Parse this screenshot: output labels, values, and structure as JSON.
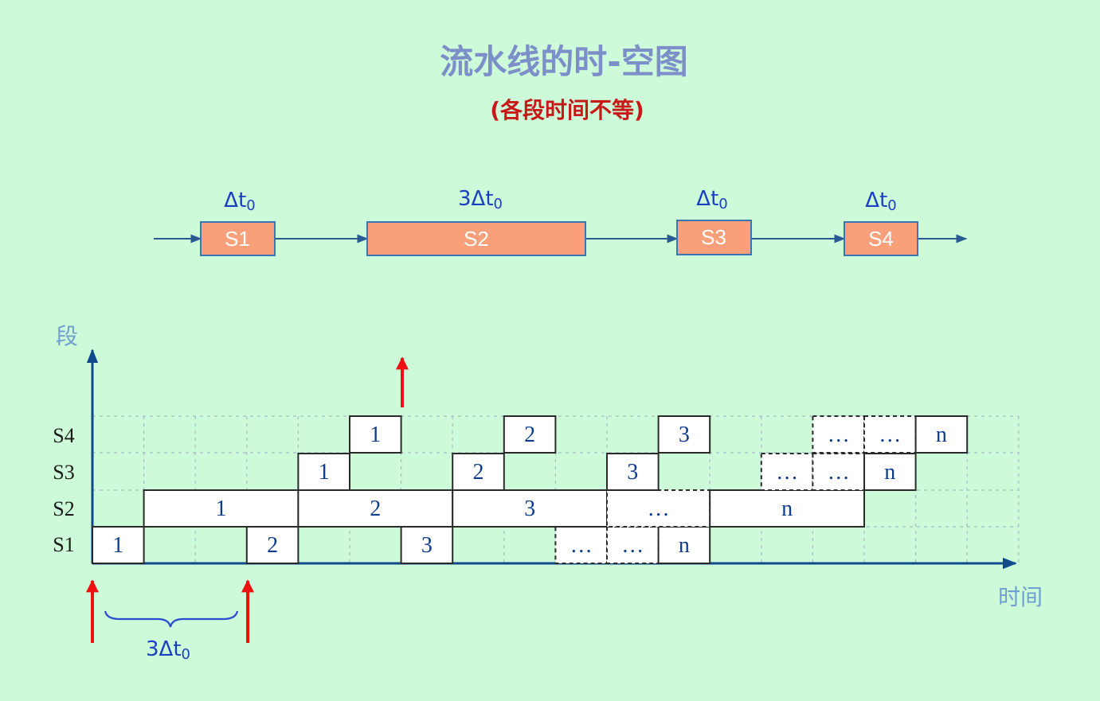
{
  "title": "流水线的时-空图",
  "subtitle": "(各段时间不等)",
  "stages": [
    {
      "name": "S1",
      "duration_label": "Δt",
      "duration_sub": "0"
    },
    {
      "name": "S2",
      "duration_label": "3Δt",
      "duration_sub": "0"
    },
    {
      "name": "S3",
      "duration_label": "Δt",
      "duration_sub": "0"
    },
    {
      "name": "S4",
      "duration_label": "Δt",
      "duration_sub": "0"
    }
  ],
  "axes": {
    "y_label": "段",
    "x_label": "时间"
  },
  "rows": [
    "S1",
    "S2",
    "S3",
    "S4"
  ],
  "brace_label": {
    "text": "3Δt",
    "sub": "0"
  },
  "colors": {
    "background": "#cdfbd9",
    "stage_fill": "#f9a07a",
    "title": "#7c8fc8",
    "subtitle": "#c81919",
    "cell_text": "#0d3c8c",
    "marker": "#ee1111"
  },
  "cells": [
    {
      "row": 0,
      "start": 0,
      "span": 1,
      "text": "1",
      "dashed": false
    },
    {
      "row": 0,
      "start": 3,
      "span": 1,
      "text": "2",
      "dashed": false
    },
    {
      "row": 0,
      "start": 6,
      "span": 1,
      "text": "3",
      "dashed": false
    },
    {
      "row": 0,
      "start": 9,
      "span": 1,
      "text": "…",
      "dashed": true
    },
    {
      "row": 0,
      "start": 10,
      "span": 1,
      "text": "…",
      "dashed": true
    },
    {
      "row": 0,
      "start": 11,
      "span": 1,
      "text": "n",
      "dashed": false
    },
    {
      "row": 1,
      "start": 1,
      "span": 3,
      "text": "1",
      "dashed": false
    },
    {
      "row": 1,
      "start": 4,
      "span": 3,
      "text": "2",
      "dashed": false
    },
    {
      "row": 1,
      "start": 7,
      "span": 3,
      "text": "3",
      "dashed": false
    },
    {
      "row": 1,
      "start": 10,
      "span": 2,
      "text": "…",
      "dashed": true
    },
    {
      "row": 1,
      "start": 12,
      "span": 3,
      "text": "n",
      "dashed": false
    },
    {
      "row": 2,
      "start": 4,
      "span": 1,
      "text": "1",
      "dashed": false
    },
    {
      "row": 2,
      "start": 7,
      "span": 1,
      "text": "2",
      "dashed": false
    },
    {
      "row": 2,
      "start": 10,
      "span": 1,
      "text": "3",
      "dashed": false
    },
    {
      "row": 2,
      "start": 13,
      "span": 1,
      "text": "…",
      "dashed": true
    },
    {
      "row": 2,
      "start": 14,
      "span": 1,
      "text": "…",
      "dashed": true
    },
    {
      "row": 2,
      "start": 15,
      "span": 1,
      "text": "n",
      "dashed": false
    },
    {
      "row": 3,
      "start": 5,
      "span": 1,
      "text": "1",
      "dashed": false
    },
    {
      "row": 3,
      "start": 8,
      "span": 1,
      "text": "2",
      "dashed": false
    },
    {
      "row": 3,
      "start": 11,
      "span": 1,
      "text": "3",
      "dashed": false
    },
    {
      "row": 3,
      "start": 14,
      "span": 1,
      "text": "…",
      "dashed": true
    },
    {
      "row": 3,
      "start": 15,
      "span": 1,
      "text": "…",
      "dashed": true
    },
    {
      "row": 3,
      "start": 16,
      "span": 1,
      "text": "n",
      "dashed": false
    }
  ]
}
